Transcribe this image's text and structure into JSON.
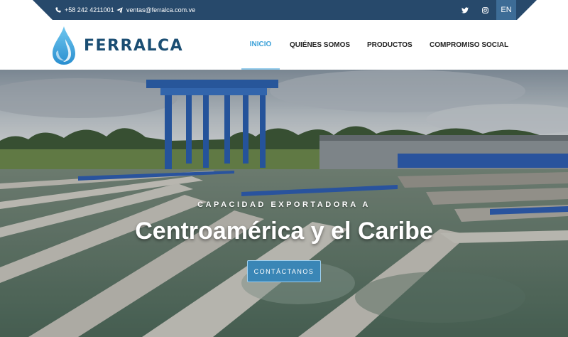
{
  "topbar": {
    "phone": "+58 242 4211001",
    "email": "ventas@ferralca.com.ve",
    "phone_icon": "phone-icon",
    "email_icon": "paper-plane-icon",
    "twitter_icon": "twitter-icon",
    "instagram_icon": "instagram-icon",
    "lang": "EN",
    "bg_color": "#27496b"
  },
  "header": {
    "logo_text": "FERRALCA",
    "logo_icon": "water-drop-icon",
    "nav": [
      {
        "label": "INICIO",
        "active": true
      },
      {
        "label": "QUIÉNES SOMOS"
      },
      {
        "label": "PRODUCTOS"
      },
      {
        "label": "COMPROMISO SOCIAL"
      }
    ],
    "accent_color": "#3aa0d8"
  },
  "hero": {
    "subtitle": "CAPACIDAD EXPORTADORA A",
    "title": "Centroamérica y el Caribe",
    "button": "CONTÁCTANOS",
    "button_color": "#3a86b6"
  }
}
